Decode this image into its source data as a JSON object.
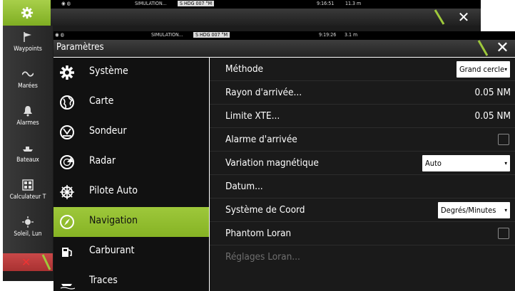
{
  "background_window": {
    "status": {
      "simulation": "SIMULATION...",
      "heading": "S HDG 007 °M",
      "time": "9:16:51",
      "depth": "11.3 m"
    },
    "close_symbol": "✕",
    "sidebar": {
      "items": [
        {
          "label": "Waypoints",
          "icon": "flag-icon"
        },
        {
          "label": "Marées",
          "icon": "tide-wave-icon"
        },
        {
          "label": "Alarmes",
          "icon": "bell-icon"
        },
        {
          "label": "Bateaux",
          "icon": "ship-icon"
        },
        {
          "label": "Calculateur T",
          "icon": "calculator-icon"
        },
        {
          "label": "Soleil, Lun",
          "icon": "sun-moon-icon"
        }
      ]
    },
    "bottom_symbol": "✕"
  },
  "dialog": {
    "status": {
      "simulation": "SIMULATION...",
      "heading": "S HDG 007 °M",
      "time": "9:19:26",
      "depth": "3.1 m"
    },
    "title": "Paramètres",
    "close_symbol": "✕",
    "menu": [
      {
        "label": "Système",
        "icon": "gear-icon"
      },
      {
        "label": "Carte",
        "icon": "globe-icon"
      },
      {
        "label": "Sondeur",
        "icon": "sonar-icon"
      },
      {
        "label": "Radar",
        "icon": "radar-icon"
      },
      {
        "label": "Pilote Auto",
        "icon": "helm-wheel-icon"
      },
      {
        "label": "Navigation",
        "icon": "compass-icon",
        "active": true
      },
      {
        "label": "Carburant",
        "icon": "fuel-pump-icon"
      },
      {
        "label": "Traces",
        "icon": "boat-trail-icon"
      }
    ],
    "settings": {
      "methode": {
        "label": "Méthode",
        "value": "Grand cercle",
        "caret": "▾"
      },
      "rayon": {
        "label": "Rayon d'arrivée...",
        "value": "0.05 NM"
      },
      "xte": {
        "label": "Limite XTE...",
        "value": "0.05 NM"
      },
      "alarme": {
        "label": "Alarme d'arrivée",
        "checked": false
      },
      "variation": {
        "label": "Variation magnétique",
        "value": "Auto",
        "caret": "▾"
      },
      "datum": {
        "label": "Datum..."
      },
      "coord": {
        "label": "Système de Coord",
        "value": "Degrés/Minutes",
        "caret": "▾"
      },
      "phantom": {
        "label": "Phantom Loran",
        "checked": false
      },
      "loran": {
        "label": "Réglages Loran...",
        "disabled": true
      }
    }
  },
  "colors": {
    "accent": "#93bf2f",
    "panel": "#1a1a1a",
    "menu": "#111111",
    "alert": "#c23a3a"
  }
}
